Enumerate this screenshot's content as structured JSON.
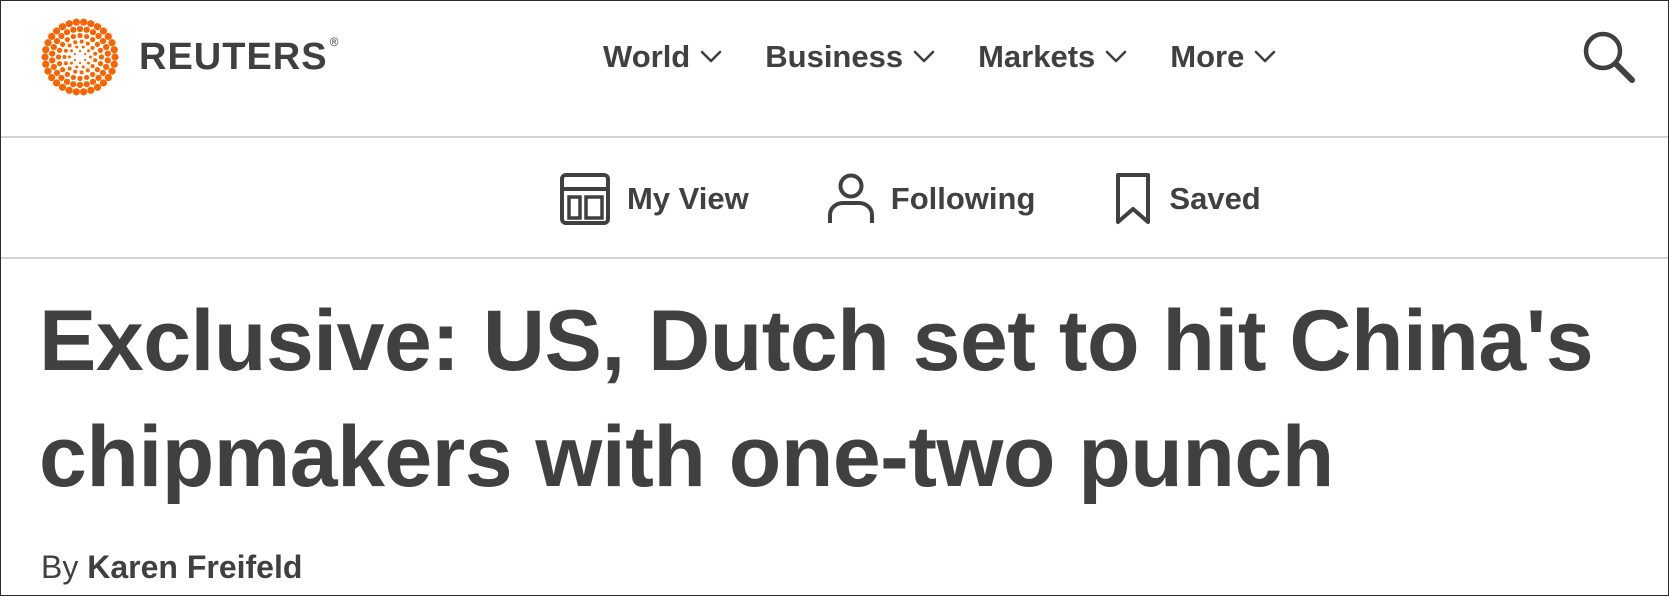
{
  "brand": {
    "name": "REUTERS",
    "registered_mark": "®",
    "logo_color": "#fa6400",
    "logo_icon": "reuters-dots-logo-icon"
  },
  "main_nav": [
    {
      "label": "World",
      "icon": "chevron-down-icon"
    },
    {
      "label": "Business",
      "icon": "chevron-down-icon"
    },
    {
      "label": "Markets",
      "icon": "chevron-down-icon"
    },
    {
      "label": "More",
      "icon": "chevron-down-icon"
    }
  ],
  "search_icon": "search-icon",
  "sub_nav": [
    {
      "label": "My View",
      "icon": "layout-dashboard-icon"
    },
    {
      "label": "Following",
      "icon": "user-icon"
    },
    {
      "label": "Saved",
      "icon": "bookmark-icon"
    }
  ],
  "article": {
    "headline": "Exclusive: US, Dutch set to hit China's chipmakers with one-two punch",
    "byline_prefix": "By",
    "author": "Karen Freifeld"
  },
  "colors": {
    "text": "#404040",
    "divider": "#d4d4d4",
    "accent": "#fa6400"
  }
}
